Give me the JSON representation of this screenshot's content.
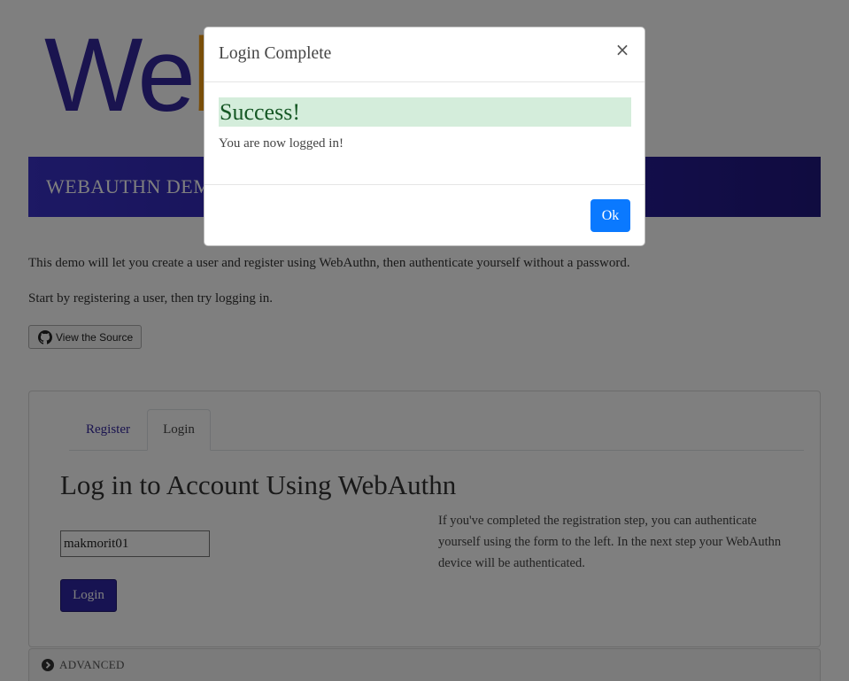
{
  "logo": {
    "text_main": "We",
    "text_accent": "b"
  },
  "banner": {
    "title": "WEBAUTHN DEMO"
  },
  "intro": {
    "line1": "This demo will let you create a user and register using WebAuthn, then authenticate yourself without a password.",
    "line2": "Start by registering a user, then try logging in."
  },
  "source_button": {
    "label": "View the Source",
    "icon": "github-icon"
  },
  "card": {
    "tabs": [
      {
        "label": "Register",
        "active": false
      },
      {
        "label": "Login",
        "active": true
      }
    ],
    "title": "Log in to Account Using WebAuthn",
    "username_value": "makmorit01",
    "login_button": "Login",
    "help_text": "If you've completed the registration step, you can authenticate yourself using the form to the left. In the next step your WebAuthn device will be authenticated."
  },
  "advanced": {
    "label": "ADVANCED",
    "icon": "chevron-right-circle-icon"
  },
  "modal": {
    "title": "Login Complete",
    "close_symbol": "×",
    "success_text": "Success!",
    "message": "You are now logged in!",
    "ok_button": "Ok"
  },
  "colors": {
    "brand": "#35289f",
    "banner_start": "#3a32c8",
    "banner_end": "#211880",
    "success_bg": "#d4eddb",
    "success_text": "#155724",
    "ok_button": "#0a79ff"
  }
}
